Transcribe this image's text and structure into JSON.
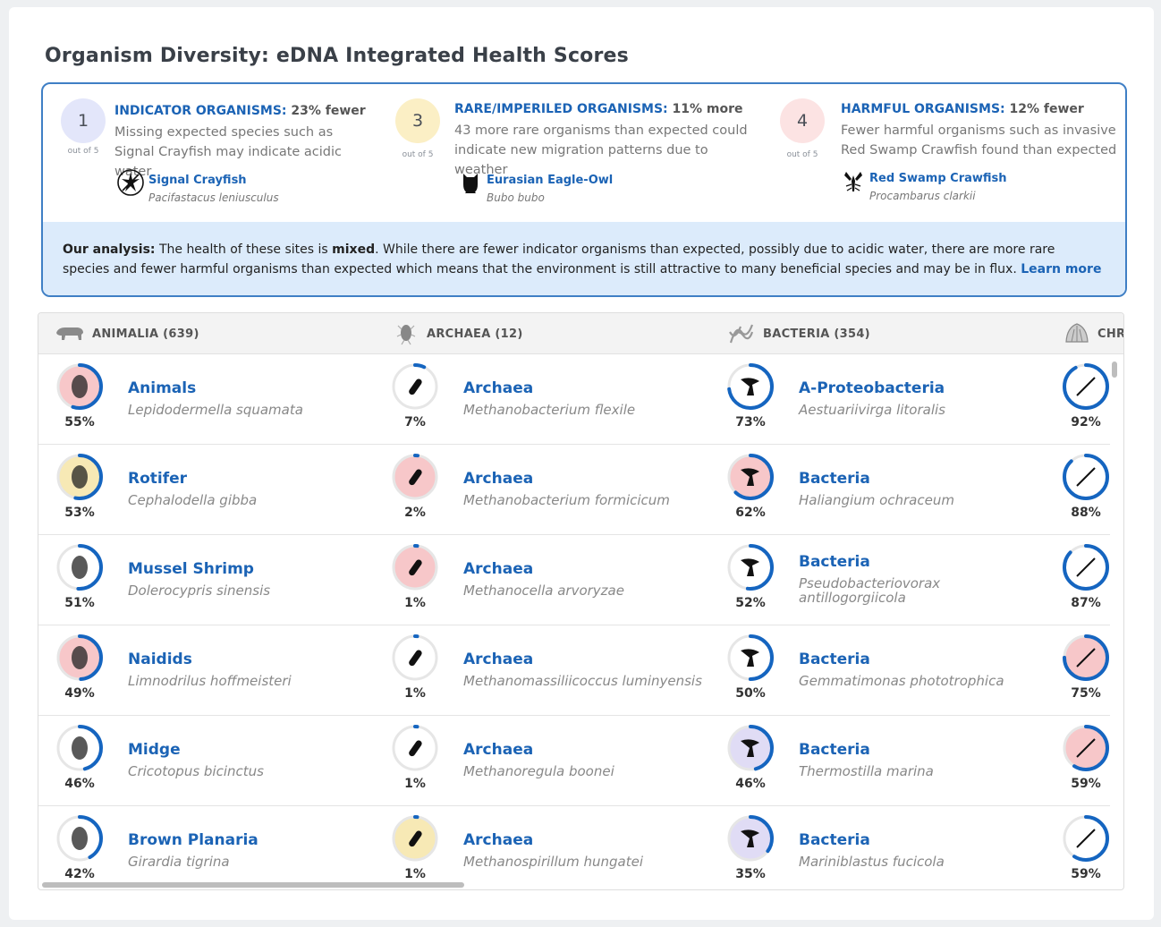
{
  "page_title": "Organism Diversity: eDNA Integrated Health Scores",
  "scores": [
    {
      "value": "1",
      "out_of": "out of 5",
      "category": "INDICATOR ORGANISMS:",
      "change": " 23% fewer",
      "description": "Missing expected species such as Signal Crayfish may indicate acidic water",
      "species_name": "Signal Crayfish",
      "species_sci": "Pacifastacus leniusculus",
      "circle_color": "#e3e6fa",
      "icon": "crayfish-icon"
    },
    {
      "value": "3",
      "out_of": "out of 5",
      "category": "RARE/IMPERILED ORGANISMS:",
      "change": " 11% more",
      "description": "43 more rare organisms than expected could indicate new migration patterns due to weather",
      "species_name": "Eurasian Eagle-Owl",
      "species_sci": "Bubo bubo",
      "circle_color": "#fbefc5",
      "icon": "owl-icon"
    },
    {
      "value": "4",
      "out_of": "out of 5",
      "category": "HARMFUL ORGANISMS:",
      "change": " 12% fewer",
      "description": "Fewer harmful organisms such as invasive Red Swamp Crawfish found than expected",
      "species_name": "Red Swamp Crawfish",
      "species_sci": "Procambarus clarkii",
      "circle_color": "#fce3e3",
      "icon": "crawfish-icon"
    }
  ],
  "analysis": {
    "label": "Our analysis:",
    "pre": "  The health of these sites is ",
    "emphasis": "mixed",
    "post": ". While there are fewer indicator organisms than expected, possibly due to acidic water, there are more rare species and fewer harmful organisms than expected which means that the environment is still attractive to many beneficial species and may be in flux. ",
    "link": "Learn more"
  },
  "columns": [
    {
      "label": "ANIMALIA (639)",
      "icon": "animal-icon"
    },
    {
      "label": "ARCHAEA (12)",
      "icon": "archaea-icon"
    },
    {
      "label": "BACTERIA (354)",
      "icon": "bacteria-icon"
    },
    {
      "label": "CHR",
      "icon": "chromista-icon"
    }
  ],
  "rows": [
    [
      {
        "name": "Animals",
        "sci": "Lepidodermella squamata",
        "pct": "55%",
        "value": 55,
        "bg": "#f7c7c9"
      },
      {
        "name": "Archaea",
        "sci": "Methanobacterium flexile",
        "pct": "7%",
        "value": 7,
        "bg": "#ffffff"
      },
      {
        "name": "A-Proteobacteria",
        "sci": "Aestuariivirga litoralis",
        "pct": "73%",
        "value": 73,
        "bg": "#ffffff"
      },
      {
        "name": "",
        "sci": "",
        "pct": "92%",
        "value": 92,
        "bg": "#ffffff"
      }
    ],
    [
      {
        "name": "Rotifer",
        "sci": "Cephalodella gibba",
        "pct": "53%",
        "value": 53,
        "bg": "#f7e9b5"
      },
      {
        "name": "Archaea",
        "sci": "Methanobacterium formicicum",
        "pct": "2%",
        "value": 2,
        "bg": "#f7c7c9"
      },
      {
        "name": "Bacteria",
        "sci": "Haliangium ochraceum",
        "pct": "62%",
        "value": 62,
        "bg": "#f7c7c9"
      },
      {
        "name": "",
        "sci": "",
        "pct": "88%",
        "value": 88,
        "bg": "#ffffff"
      }
    ],
    [
      {
        "name": "Mussel Shrimp",
        "sci": "Dolerocypris sinensis",
        "pct": "51%",
        "value": 51,
        "bg": "#ffffff"
      },
      {
        "name": "Archaea",
        "sci": "Methanocella arvoryzae",
        "pct": "1%",
        "value": 1,
        "bg": "#f7c7c9"
      },
      {
        "name": "Bacteria",
        "sci": "Pseudobacteriovorax antillogorgiicola",
        "pct": "52%",
        "value": 52,
        "bg": "#ffffff"
      },
      {
        "name": "",
        "sci": "",
        "pct": "87%",
        "value": 87,
        "bg": "#ffffff"
      }
    ],
    [
      {
        "name": "Naidids",
        "sci": "Limnodrilus hoffmeisteri",
        "pct": "49%",
        "value": 49,
        "bg": "#f7c7c9"
      },
      {
        "name": "Archaea",
        "sci": "Methanomassiliicoccus luminyensis",
        "pct": "1%",
        "value": 1,
        "bg": "#ffffff"
      },
      {
        "name": "Bacteria",
        "sci": "Gemmatimonas phototrophica",
        "pct": "50%",
        "value": 50,
        "bg": "#ffffff"
      },
      {
        "name": "",
        "sci": "",
        "pct": "75%",
        "value": 75,
        "bg": "#f7c7c9"
      }
    ],
    [
      {
        "name": "Midge",
        "sci": "Cricotopus bicinctus",
        "pct": "46%",
        "value": 46,
        "bg": "#ffffff"
      },
      {
        "name": "Archaea",
        "sci": "Methanoregula boonei",
        "pct": "1%",
        "value": 1,
        "bg": "#ffffff"
      },
      {
        "name": "Bacteria",
        "sci": "Thermostilla marina",
        "pct": "46%",
        "value": 46,
        "bg": "#e0dcf5"
      },
      {
        "name": "",
        "sci": "",
        "pct": "59%",
        "value": 59,
        "bg": "#f7c7c9"
      }
    ],
    [
      {
        "name": "Brown Planaria",
        "sci": "Girardia tigrina",
        "pct": "42%",
        "value": 42,
        "bg": "#ffffff"
      },
      {
        "name": "Archaea",
        "sci": "Methanospirillum hungatei",
        "pct": "1%",
        "value": 1,
        "bg": "#f7e9b5"
      },
      {
        "name": "Bacteria",
        "sci": "Mariniblastus fucicola",
        "pct": "35%",
        "value": 35,
        "bg": "#e0dcf5"
      },
      {
        "name": "",
        "sci": "",
        "pct": "59%",
        "value": 59,
        "bg": "#ffffff"
      }
    ]
  ],
  "colors": {
    "accent": "#1b63b5",
    "ring": "#1565c0",
    "ring_track": "#e6e6e6",
    "summary_border": "#3f7fc5",
    "analysis_bg": "#dcebfb"
  }
}
